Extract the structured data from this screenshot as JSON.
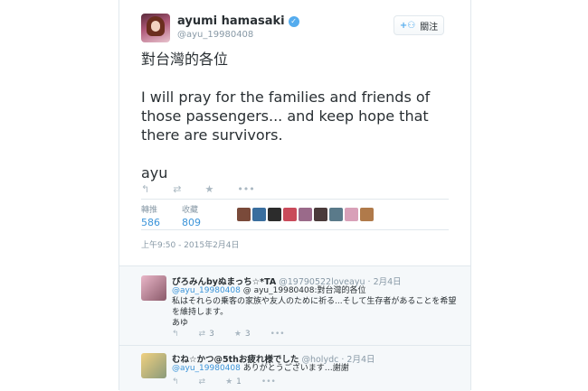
{
  "user": {
    "name": "ayumi hamasaki",
    "handle": "@ayu_19980408"
  },
  "follow": {
    "label": "關注"
  },
  "tweet": {
    "lines": [
      "對台灣的各位",
      "I will pray for the families and friends of those passengers... and keep hope that there are survivors.",
      "ayu"
    ],
    "timestamp": "上午9:50 - 2015年2月4日"
  },
  "stats": {
    "retweets_label": "轉推",
    "retweets": "586",
    "favorites_label": "收藏",
    "favorites": "809"
  },
  "icons": {
    "reply": "reply-icon",
    "retweet": "retweet-icon",
    "favorite": "star-icon",
    "more": "more-icon",
    "verified": "verified-icon",
    "follow": "add-user-icon"
  },
  "colors": {
    "link": "#3b94d9",
    "verified": "#55acee",
    "muted": "#8899a6",
    "action": "#aab8c2"
  },
  "replies": [
    {
      "name": "ぴろみんbyぬまっち☆*TA",
      "handle": "@19790522loveayu",
      "time": "2月4日",
      "mention": "@ayu_19980408",
      "text": "@ ayu_19980408:對台灣的各位",
      "line2": "私はそれらの乗客の家族や友人のために祈る...そして生存者があることを希望を維持します。",
      "line3": "あゆ",
      "retweets": "3",
      "favorites": "3"
    },
    {
      "name": "むね☆かつ@5thお疲れ様でした",
      "handle": "@holydc",
      "time": "2月4日",
      "mention": "@ayu_19980408",
      "text": "ありがとうございます…謝謝",
      "favorites": "1"
    }
  ]
}
